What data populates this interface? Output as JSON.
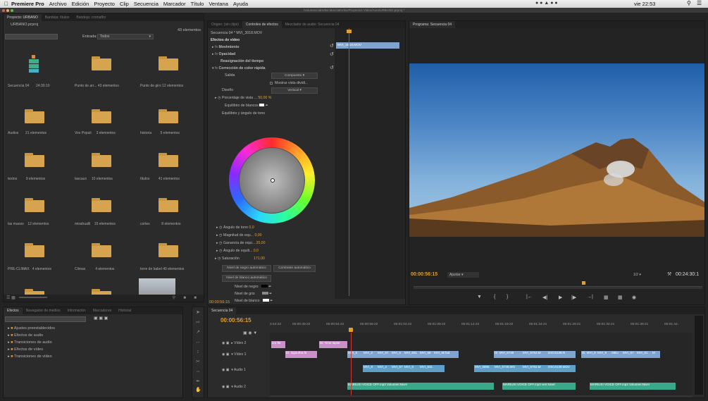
{
  "menu": {
    "app": "Premiere Pro",
    "items": [
      "Archivo",
      "Edición",
      "Proyecto",
      "Clip",
      "Secuencia",
      "Marcador",
      "Título",
      "Ventana",
      "Ayuda"
    ],
    "status_time": "vie 22:53"
  },
  "window_title": "/Volumes/JahViko Mac/JahViko/Proyectos Video/Auro/URBANO.prproj *",
  "project": {
    "tabs": [
      "Proyecto: URBANO",
      "Bandeja: títulos",
      "Bandeja: cromaflor"
    ],
    "file": "URBANO.prproj",
    "count": "43 elementos",
    "filter_label": "Entrada:",
    "filter_value": "Todos",
    "bins": [
      {
        "name": "Secuencia 04",
        "meta": "24:30:10"
      },
      {
        "name": "Punto de arr...",
        "meta": "43 elementos"
      },
      {
        "name": "Punto de giro",
        "meta": "12 elementos"
      },
      {
        "name": "Audios",
        "meta": "21 elementos"
      },
      {
        "name": "Vox Populi",
        "meta": "3 elementos"
      },
      {
        "name": "historia",
        "meta": "5 elementos"
      },
      {
        "name": "textos",
        "meta": "9 elementos"
      },
      {
        "name": "lascaux",
        "meta": "10 elementos"
      },
      {
        "name": "títulos",
        "meta": "41 elementos"
      },
      {
        "name": "las manos",
        "meta": "12 elementos"
      },
      {
        "name": "misahualli",
        "meta": "15 elementos"
      },
      {
        "name": "cortes",
        "meta": "8 elementos"
      },
      {
        "name": "PRE-CLIMAX",
        "meta": "4 elementos"
      },
      {
        "name": "Climax",
        "meta": "4 elementos"
      },
      {
        "name": "torre de babel",
        "meta": "40 elementos"
      }
    ]
  },
  "effect_controls": {
    "tabs": [
      "Origen: (sin clips)",
      "Controles de efectos",
      "Mezclador de audio: Secuencia 04"
    ],
    "header": "Secuencia 04 * MVI_3018.MOV",
    "clip_name": "MVI_3018.MOV",
    "section": "Efectos de vídeo",
    "motion": "Movimiento",
    "opacity": "Opacidad",
    "remap": "Reasignación del tiempo",
    "color": "Corrección de color rápida",
    "salida_label": "Salida",
    "salida_value": "Compuesto",
    "split_label": "Mostrar vista dividi...",
    "diseno_label": "Diseño",
    "diseno_value": "Vertical",
    "porcentaje_label": "Porcentaje de vista ...",
    "porcentaje_value": "50,00 %",
    "balance_label": "Equilibrio de blancos",
    "tone_label": "Equilibrio y ángulo de tono",
    "angulo_tono_label": "Ángulo de tono",
    "angulo_tono_value": "0,0",
    "magnitud_label": "Magnitud de equ...",
    "magnitud_value": "0,00",
    "ganancia_label": "Ganancia de equi...",
    "ganancia_value": "20,00",
    "angulo_equi_label": "Ángulo de equili...",
    "angulo_equi_value": "0,0",
    "saturacion_label": "Saturación",
    "saturacion_value": "171,00",
    "btn_auto_black": "Nivel de negro automático",
    "btn_auto_contrast": "Contraste automático",
    "btn_auto_white": "Nivel de blanco automático",
    "nivel_negro": "Nivel de negro",
    "nivel_gris": "Nivel de gris",
    "nivel_blanco": "Nivel de blanco",
    "timecode": "00:00:56:15"
  },
  "program": {
    "tab": "Programa: Secuencia 04",
    "timecode": "00:00:56:15",
    "fit": "Ajustar",
    "quality": "1/2",
    "duration": "00:24:30:1"
  },
  "effects_panel": {
    "tabs": [
      "Efectos",
      "Navegador de medios",
      "Información",
      "Marcadores",
      "Historial"
    ],
    "items": [
      "Ajustes preestablecidos",
      "Efectos de audio",
      "Transiciones de audio",
      "Efectos de vídeo",
      "Transiciones de vídeo"
    ]
  },
  "timeline": {
    "tab": "Secuencia 04",
    "timecode": "00:00:56:15",
    "ruler": [
      "3:44:22",
      "00:00:49:22",
      "00:00:54:22",
      "00:00:59:22",
      "00:01:04:22",
      "00:01:09:22",
      "00:01:14:22",
      "00:01:19:22",
      "00:01:24:21",
      "00:01:29:21",
      "00:01:34:21",
      "00:01:39:21",
      "00:01:44:"
    ],
    "tracks": [
      "Vídeo 2",
      "Vídeo 1",
      "Audio 1",
      "Audio 2"
    ],
    "v2_clips": [
      "cro fte",
      "Di: logourba fa",
      "Di: Time lapse"
    ],
    "v1_clips": [
      "MVI_8",
      "MVI_2",
      "MVI_57",
      "MVI_5",
      "MVI_831",
      "MVI_58",
      "MVI_5E",
      "fad",
      "Di: MVI_5748",
      "MVI_5752.M",
      "DSC0139.N",
      "Di: MVI_8",
      "MVI_9",
      "niBU",
      "MVI_57",
      "MVI_61",
      "M"
    ],
    "a1_clips": [
      "MVI_8",
      "MVI_2",
      "MVI_57",
      "MVI_5",
      "MVI_831",
      "MVI_5855",
      "MVI_5748.MO",
      "MVI_5752.M",
      "DSC0139.MOV"
    ],
    "a2_clips": [
      "MARIUXI VOICE OFF.mp3",
      "Volumen:Nivel",
      "MARIUXI VOICE OFF.mp3",
      "ven:Nivel",
      "MARIUXI VOICE OFF.mp3",
      "Volumen:Nivel"
    ]
  }
}
